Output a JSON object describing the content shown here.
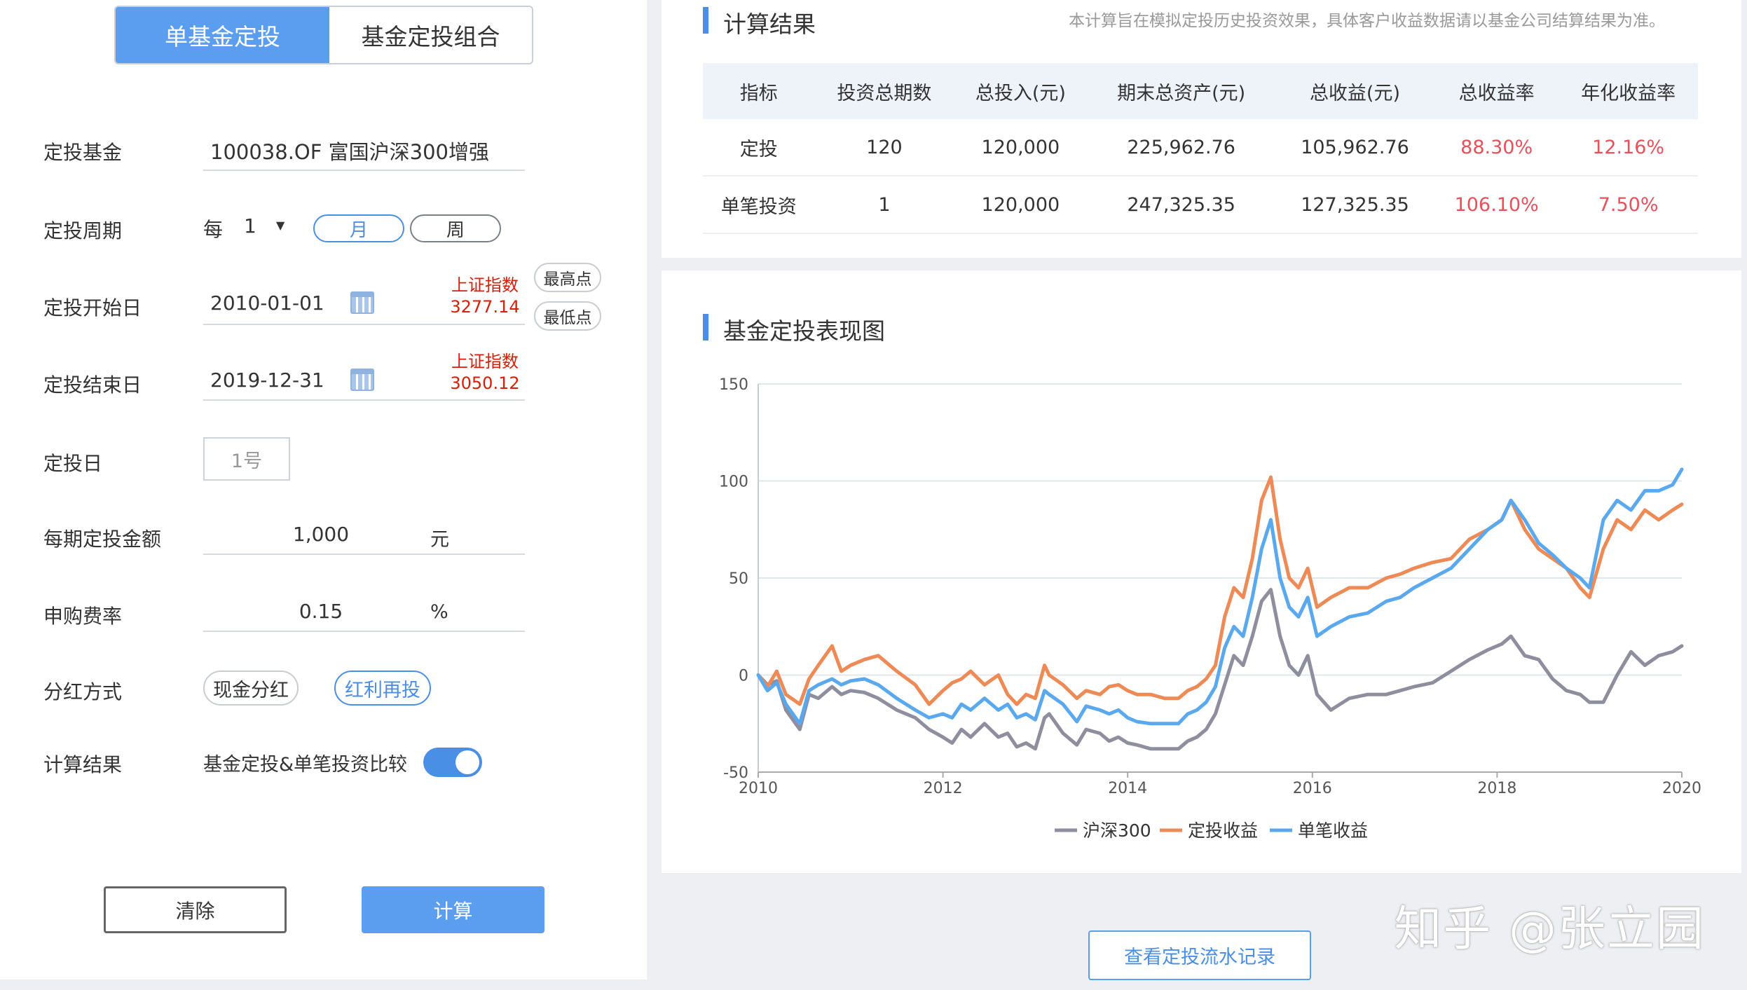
{
  "tabs": [
    "单基金定投",
    "基金定投组合"
  ],
  "form": {
    "fund_label": "定投基金",
    "fund_value": "100038.OF 富国沪深300增强",
    "period_label": "定投周期",
    "period_every": "每",
    "period_num": "1",
    "period_arrow": "▼",
    "period_month": "月",
    "period_week": "周",
    "start_label": "定投开始日",
    "start_value": "2010-01-01",
    "start_index_name": "上证指数",
    "start_index_value": "3277.14",
    "btn_high": "最高点",
    "btn_low": "最低点",
    "end_label": "定投结束日",
    "end_value": "2019-12-31",
    "end_index_name": "上证指数",
    "end_index_value": "3050.12",
    "day_label": "定投日",
    "day_value": "1号",
    "amount_label": "每期定投金额",
    "amount_value": "1,000",
    "amount_unit": "元",
    "fee_label": "申购费率",
    "fee_value": "0.15",
    "fee_unit": "%",
    "dividend_label": "分红方式",
    "dividend_cash": "现金分红",
    "dividend_reinvest": "红利再投",
    "result_label": "计算结果",
    "result_compare": "基金定投&单笔投资比较",
    "clear_btn": "清除",
    "calc_btn": "计算"
  },
  "results": {
    "title": "计算结果",
    "note": "本计算旨在模拟定投历史投资效果，具体客户收益数据请以基金公司结算结果为准。",
    "headers": [
      "指标",
      "投资总期数",
      "总投入(元)",
      "期末总资产(元)",
      "总收益(元)",
      "总收益率",
      "年化收益率"
    ],
    "rows": [
      [
        "定投",
        "120",
        "120,000",
        "225,962.76",
        "105,962.76",
        "88.30%",
        "12.16%"
      ],
      [
        "单笔投资",
        "1",
        "120,000",
        "247,325.35",
        "127,325.35",
        "106.10%",
        "7.50%"
      ]
    ]
  },
  "chart_title": "基金定投表现图",
  "flow_button": "查看定投流水记录",
  "watermark": "知乎 @张立园",
  "colors": {
    "accent": "#5b9ef0",
    "hs300": "#8e8e9e",
    "dingtou": "#ee8a55",
    "danbi": "#5aa9ee",
    "positive": "#e8505b"
  },
  "chart_data": {
    "type": "line",
    "x_unit": "year",
    "xlim": [
      2010,
      2020
    ],
    "ylim": [
      -50,
      150
    ],
    "xticks": [
      2010,
      2012,
      2014,
      2016,
      2018,
      2020
    ],
    "yticks": [
      -50,
      0,
      50,
      100,
      150
    ],
    "grid": true,
    "legend_position": "bottom-center",
    "series": [
      {
        "name": "沪深300",
        "color": "#8e8e9e",
        "x": [
          2010.0,
          2010.1,
          2010.2,
          2010.3,
          2010.45,
          2010.55,
          2010.65,
          2010.8,
          2010.9,
          2011.0,
          2011.15,
          2011.3,
          2011.5,
          2011.7,
          2011.85,
          2012.0,
          2012.1,
          2012.2,
          2012.3,
          2012.45,
          2012.6,
          2012.7,
          2012.8,
          2012.9,
          2013.0,
          2013.1,
          2013.15,
          2013.3,
          2013.45,
          2013.55,
          2013.7,
          2013.8,
          2013.9,
          2014.0,
          2014.1,
          2014.25,
          2014.4,
          2014.55,
          2014.65,
          2014.75,
          2014.85,
          2014.95,
          2015.05,
          2015.15,
          2015.25,
          2015.35,
          2015.45,
          2015.55,
          2015.65,
          2015.75,
          2015.85,
          2015.95,
          2016.05,
          2016.2,
          2016.4,
          2016.6,
          2016.8,
          2016.95,
          2017.1,
          2017.3,
          2017.5,
          2017.7,
          2017.9,
          2018.05,
          2018.15,
          2018.3,
          2018.45,
          2018.6,
          2018.75,
          2018.9,
          2019.0,
          2019.15,
          2019.3,
          2019.45,
          2019.6,
          2019.75,
          2019.9,
          2020.0
        ],
        "y": [
          0,
          -5,
          -3,
          -18,
          -28,
          -10,
          -12,
          -6,
          -10,
          -8,
          -9,
          -12,
          -18,
          -22,
          -28,
          -32,
          -35,
          -28,
          -32,
          -25,
          -32,
          -30,
          -37,
          -35,
          -38,
          -22,
          -20,
          -30,
          -36,
          -28,
          -30,
          -34,
          -32,
          -35,
          -36,
          -38,
          -38,
          -38,
          -34,
          -32,
          -28,
          -20,
          -5,
          10,
          5,
          20,
          38,
          44,
          20,
          5,
          0,
          10,
          -10,
          -18,
          -12,
          -10,
          -10,
          -8,
          -6,
          -4,
          2,
          8,
          13,
          16,
          20,
          10,
          8,
          -2,
          -8,
          -10,
          -14,
          -14,
          0,
          12,
          5,
          10,
          12,
          15
        ]
      },
      {
        "name": "定投收益",
        "color": "#ee8a55",
        "x": [
          2010.0,
          2010.1,
          2010.2,
          2010.3,
          2010.45,
          2010.55,
          2010.65,
          2010.8,
          2010.9,
          2011.0,
          2011.15,
          2011.3,
          2011.5,
          2011.7,
          2011.85,
          2012.0,
          2012.1,
          2012.2,
          2012.3,
          2012.45,
          2012.6,
          2012.7,
          2012.8,
          2012.9,
          2013.0,
          2013.1,
          2013.15,
          2013.3,
          2013.45,
          2013.55,
          2013.7,
          2013.8,
          2013.9,
          2014.0,
          2014.1,
          2014.25,
          2014.4,
          2014.55,
          2014.65,
          2014.75,
          2014.85,
          2014.95,
          2015.05,
          2015.15,
          2015.25,
          2015.35,
          2015.45,
          2015.55,
          2015.65,
          2015.75,
          2015.85,
          2015.95,
          2016.05,
          2016.2,
          2016.4,
          2016.6,
          2016.8,
          2016.95,
          2017.1,
          2017.3,
          2017.5,
          2017.7,
          2017.9,
          2018.05,
          2018.15,
          2018.3,
          2018.45,
          2018.6,
          2018.75,
          2018.9,
          2019.0,
          2019.15,
          2019.3,
          2019.45,
          2019.6,
          2019.75,
          2019.9,
          2020.0
        ],
        "y": [
          0,
          -6,
          2,
          -10,
          -15,
          -2,
          5,
          15,
          2,
          5,
          8,
          10,
          2,
          -5,
          -15,
          -8,
          -4,
          -2,
          2,
          -5,
          0,
          -10,
          -15,
          -10,
          -12,
          5,
          0,
          -5,
          -12,
          -8,
          -10,
          -6,
          -5,
          -8,
          -10,
          -10,
          -12,
          -12,
          -8,
          -6,
          -2,
          5,
          30,
          45,
          40,
          60,
          90,
          102,
          70,
          50,
          45,
          55,
          35,
          40,
          45,
          45,
          50,
          52,
          55,
          58,
          60,
          70,
          75,
          80,
          90,
          75,
          65,
          60,
          55,
          45,
          40,
          65,
          80,
          75,
          85,
          80,
          85,
          88
        ]
      },
      {
        "name": "单笔收益",
        "color": "#5aa9ee",
        "x": [
          2010.0,
          2010.1,
          2010.2,
          2010.3,
          2010.45,
          2010.55,
          2010.65,
          2010.8,
          2010.9,
          2011.0,
          2011.15,
          2011.3,
          2011.5,
          2011.7,
          2011.85,
          2012.0,
          2012.1,
          2012.2,
          2012.3,
          2012.45,
          2012.6,
          2012.7,
          2012.8,
          2012.9,
          2013.0,
          2013.1,
          2013.15,
          2013.3,
          2013.45,
          2013.55,
          2013.7,
          2013.8,
          2013.9,
          2014.0,
          2014.1,
          2014.25,
          2014.4,
          2014.55,
          2014.65,
          2014.75,
          2014.85,
          2014.95,
          2015.05,
          2015.15,
          2015.25,
          2015.35,
          2015.45,
          2015.55,
          2015.65,
          2015.75,
          2015.85,
          2015.95,
          2016.05,
          2016.2,
          2016.4,
          2016.6,
          2016.8,
          2016.95,
          2017.1,
          2017.3,
          2017.5,
          2017.7,
          2017.9,
          2018.05,
          2018.15,
          2018.3,
          2018.45,
          2018.6,
          2018.75,
          2018.9,
          2019.0,
          2019.15,
          2019.3,
          2019.45,
          2019.6,
          2019.75,
          2019.9,
          2020.0
        ],
        "y": [
          0,
          -8,
          -4,
          -15,
          -25,
          -8,
          -5,
          -2,
          -5,
          -3,
          -2,
          -5,
          -12,
          -18,
          -22,
          -20,
          -22,
          -15,
          -18,
          -12,
          -18,
          -15,
          -22,
          -20,
          -23,
          -8,
          -10,
          -15,
          -24,
          -16,
          -18,
          -20,
          -18,
          -22,
          -24,
          -25,
          -25,
          -25,
          -20,
          -18,
          -14,
          -6,
          14,
          25,
          20,
          40,
          65,
          80,
          50,
          35,
          30,
          40,
          20,
          25,
          30,
          32,
          38,
          40,
          45,
          50,
          55,
          65,
          75,
          80,
          90,
          80,
          68,
          62,
          55,
          50,
          45,
          80,
          90,
          85,
          95,
          95,
          98,
          106
        ]
      }
    ]
  }
}
